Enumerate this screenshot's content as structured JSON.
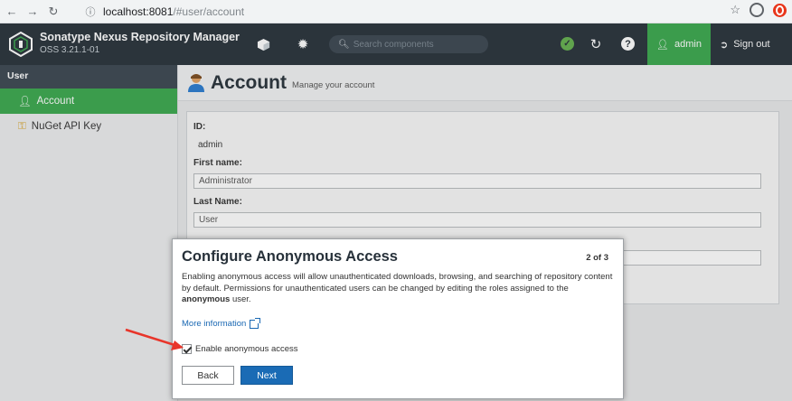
{
  "browser": {
    "url_host": "localhost:8081",
    "url_path": "/#user/account"
  },
  "header": {
    "app_name": "Sonatype Nexus Repository Manager",
    "version": "OSS 3.21.1-01",
    "search_placeholder": "Search components",
    "user_label": "admin",
    "signout_label": "Sign out"
  },
  "sidebar": {
    "section": "User",
    "items": [
      {
        "label": "Account",
        "icon": "user-icon",
        "active": true
      },
      {
        "label": "NuGet API Key",
        "icon": "key-icon",
        "active": false
      }
    ]
  },
  "page": {
    "title": "Account",
    "subtitle": "Manage your account",
    "fields": {
      "id_label": "ID:",
      "id_value": "admin",
      "first_name_label": "First name:",
      "first_name_value": "Administrator",
      "last_name_label": "Last Name:",
      "last_name_value": "User"
    }
  },
  "dialog": {
    "title": "Configure Anonymous Access",
    "step": "2 of 3",
    "body_pre": "Enabling anonymous access will allow unauthenticated downloads, browsing, and searching of repository content by default. Permissions for unauthenticated users can be changed by editing the roles assigned to the ",
    "body_bold": "anonymous",
    "body_post": " user.",
    "more_info": "More information",
    "checkbox_label": "Enable anonymous access",
    "checkbox_checked": true,
    "back_label": "Back",
    "next_label": "Next"
  },
  "colors": {
    "header_bg": "#27313a",
    "accent_green": "#3aa84d",
    "primary_blue": "#1a6bb5",
    "arrow_red": "#e8352a"
  }
}
